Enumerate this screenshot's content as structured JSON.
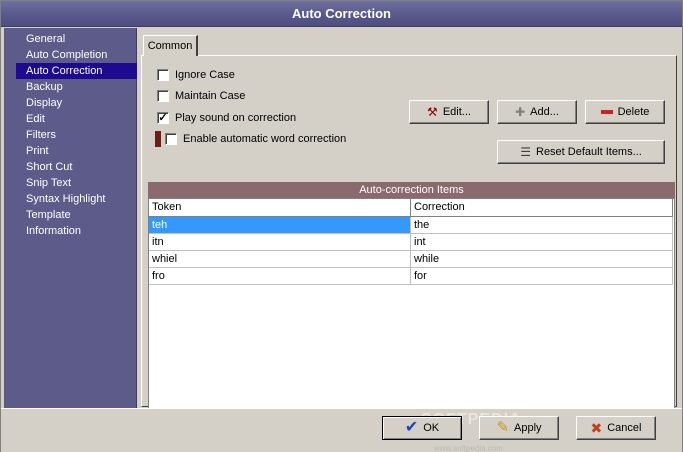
{
  "window": {
    "title": "Auto Correction"
  },
  "sidebar": {
    "items": [
      {
        "label": "General"
      },
      {
        "label": "Auto Completion"
      },
      {
        "label": "Auto Correction",
        "selected": true
      },
      {
        "label": "Backup"
      },
      {
        "label": "Display"
      },
      {
        "label": "Edit"
      },
      {
        "label": "Filters"
      },
      {
        "label": "Print"
      },
      {
        "label": "Short Cut"
      },
      {
        "label": "Snip Text"
      },
      {
        "label": "Syntax Highlight"
      },
      {
        "label": "Template"
      },
      {
        "label": "Information"
      }
    ]
  },
  "tabs": [
    {
      "label": "Common",
      "active": true
    }
  ],
  "options": {
    "ignore_case": {
      "label": "Ignore Case",
      "checked": false
    },
    "maintain_case": {
      "label": "Maintain Case",
      "checked": false
    },
    "play_sound": {
      "label": "Play sound on correction",
      "checked": true
    },
    "enable_auto": {
      "label": "Enable automatic word correction",
      "checked": false
    }
  },
  "buttons": {
    "edit": {
      "label": "Edit...",
      "icon": "edit-pencil-icon"
    },
    "add": {
      "label": "Add...",
      "icon": "plus-icon"
    },
    "delete": {
      "label": "Delete",
      "icon": "minus-icon"
    },
    "reset": {
      "label": "Reset Default Items...",
      "icon": "list-icon"
    }
  },
  "grid": {
    "title": "Auto-correction  Items",
    "columns": [
      "Token",
      "Correction"
    ],
    "rows": [
      {
        "token": "teh",
        "correction": "the",
        "selected": true
      },
      {
        "token": "itn",
        "correction": "int"
      },
      {
        "token": "whiel",
        "correction": "while"
      },
      {
        "token": "fro",
        "correction": "for"
      }
    ]
  },
  "footer": {
    "ok": {
      "label": "OK",
      "icon": "checkmark-icon"
    },
    "apply": {
      "label": "Apply",
      "icon": "check-pencil-icon"
    },
    "cancel": {
      "label": "Cancel",
      "icon": "x-icon"
    },
    "watermark": "SOFTPEDIA",
    "watermark_url": "www.softpedia.com"
  },
  "colors": {
    "sidebar_bg": "#5c5b8a",
    "sidebar_selected": "#1e0a8e",
    "grid_title_bg": "#8a6a6e",
    "row_selected": "#3399ff",
    "face": "#d4d0c8"
  }
}
